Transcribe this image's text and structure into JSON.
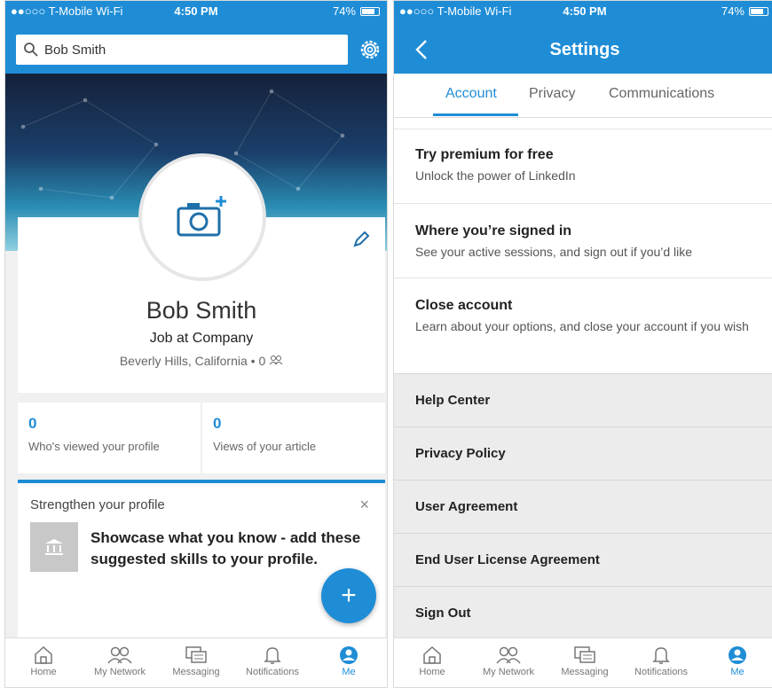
{
  "status": {
    "carrier": "●●○○○ T-Mobile Wi-Fi",
    "time": "4:50 PM",
    "battery": "74%"
  },
  "profile_screen": {
    "search": {
      "value": "Bob Smith"
    },
    "name": "Bob Smith",
    "job": "Job at Company",
    "location": "Beverly Hills, California • 0",
    "stats": [
      {
        "value": "0",
        "label": "Who's viewed your profile"
      },
      {
        "value": "0",
        "label": "Views of your article"
      }
    ],
    "strengthen": {
      "title": "Strengthen your profile",
      "close": "×",
      "text": "Showcase what you know - add these suggested skills to your profile."
    },
    "fab": "+"
  },
  "settings_screen": {
    "title": "Settings",
    "tabs": [
      "Account",
      "Privacy",
      "Communications"
    ],
    "items": [
      {
        "title": "Try premium for free",
        "subtitle": "Unlock the power of LinkedIn"
      },
      {
        "title": "Where you’re signed in",
        "subtitle": "See your active sessions, and sign out if you’d like"
      },
      {
        "title": "Close account",
        "subtitle": "Learn about your options, and close your account if you wish"
      }
    ],
    "links": [
      "Help Center",
      "Privacy Policy",
      "User Agreement",
      "End User License Agreement",
      "Sign Out"
    ]
  },
  "tabbar": [
    "Home",
    "My Network",
    "Messaging",
    "Notifications",
    "Me"
  ],
  "colors": {
    "accent": "#1f8dd6"
  }
}
